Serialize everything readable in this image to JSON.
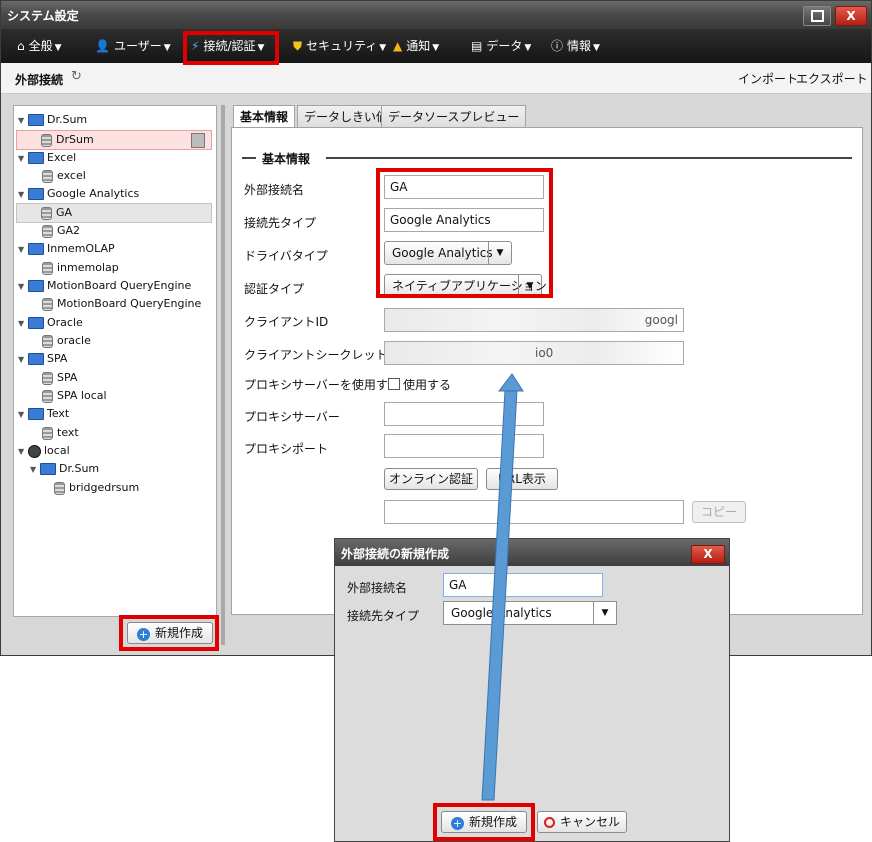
{
  "window": {
    "title": "システム設定",
    "maximize_icon": "maximize-icon",
    "close_label": "X"
  },
  "menu": [
    {
      "label": "全般",
      "icon": "home-icon"
    },
    {
      "label": "ユーザー",
      "icon": "user-icon"
    },
    {
      "label": "接続/認証",
      "icon": "plug-icon"
    },
    {
      "label": "セキュリティ",
      "icon": "shield-icon"
    },
    {
      "label": "通知",
      "icon": "bell-icon"
    },
    {
      "label": "データ",
      "icon": "data-icon"
    },
    {
      "label": "情報",
      "icon": "info-icon"
    }
  ],
  "subbar": {
    "title": "外部接続",
    "import": "インポート",
    "export": "エクスポート"
  },
  "tree": [
    {
      "label": "Dr.Sum",
      "type": "folder"
    },
    {
      "label": "DrSum",
      "type": "db"
    },
    {
      "label": "Excel",
      "type": "folder"
    },
    {
      "label": "excel",
      "type": "db"
    },
    {
      "label": "Google Analytics",
      "type": "folder"
    },
    {
      "label": "GA",
      "type": "db"
    },
    {
      "label": "GA2",
      "type": "db"
    },
    {
      "label": "InmemOLAP",
      "type": "folder"
    },
    {
      "label": "inmemolap",
      "type": "db"
    },
    {
      "label": "MotionBoard QueryEngine",
      "type": "folder"
    },
    {
      "label": "MotionBoard QueryEngine",
      "type": "db"
    },
    {
      "label": "Oracle",
      "type": "folder"
    },
    {
      "label": "oracle",
      "type": "db"
    },
    {
      "label": "SPA",
      "type": "folder"
    },
    {
      "label": "SPA",
      "type": "db"
    },
    {
      "label": "SPA local",
      "type": "db"
    },
    {
      "label": "Text",
      "type": "folder"
    },
    {
      "label": "text",
      "type": "db"
    },
    {
      "label": "local",
      "type": "globe"
    },
    {
      "label": "Dr.Sum",
      "type": "folder"
    },
    {
      "label": "bridgedrsum",
      "type": "db"
    }
  ],
  "left_new_button": "新規作成",
  "tabs": [
    "基本情報",
    "データしきい値",
    "データソースプレビュー"
  ],
  "form": {
    "section": "基本情報",
    "labels": {
      "name": "外部接続名",
      "conn_type": "接続先タイプ",
      "driver_type": "ドライバタイプ",
      "auth_type": "認証タイプ",
      "client_id": "クライアントID",
      "client_secret": "クライアントシークレット",
      "use_proxy": "プロキシサーバーを使用する",
      "proxy_server": "プロキシサーバー",
      "proxy_port": "プロキシポート"
    },
    "values": {
      "name": "GA",
      "conn_type": "Google Analytics",
      "driver_type": "Google Analytics",
      "auth_type": "ネイティブアプリケーション",
      "client_id": "googl",
      "client_secret": "io0",
      "use_proxy": "使用する",
      "proxy_server": "",
      "proxy_port": ""
    },
    "online_auth": "オンライン認証",
    "url_show": "URL表示",
    "copy": "コピー"
  },
  "dialog": {
    "title": "外部接続の新規作成",
    "close_label": "X",
    "name_label": "外部接続名",
    "name_value": "GA",
    "type_label": "接続先タイプ",
    "type_value": "Google Analytics",
    "create": "新規作成",
    "cancel": "キャンセル"
  }
}
